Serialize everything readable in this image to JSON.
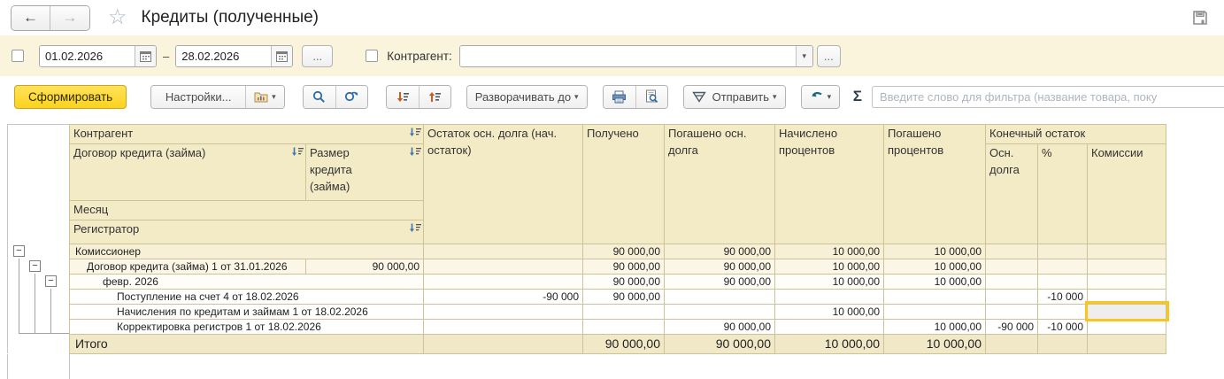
{
  "glyphs": {
    "back": "←",
    "forward": "→",
    "star": "☆",
    "dash": "–",
    "ellipsis": "...",
    "caret": "▾",
    "minus": "−",
    "sigma": "Σ"
  },
  "titlebar": {
    "title": "Кредиты (полученные)"
  },
  "filterbar": {
    "date_from": "01.02.2026",
    "date_to": "28.02.2026",
    "counterparty_label": "Контрагент:",
    "counterparty_value": ""
  },
  "toolbar": {
    "generate_label": "Сформировать",
    "settings_label": "Настройки...",
    "expand_to_label": "Разворачивать до",
    "send_label": "Отправить",
    "filter_placeholder": "Введите слово для фильтра (название товара, поку"
  },
  "report": {
    "headers": {
      "kontragent": "Контрагент",
      "dogovor": "Договор кредита (займа)",
      "razmer": "Размер кредита (займа)",
      "mesyac": "Месяц",
      "registrator": "Регистратор",
      "ostatok": "Остаток осн. долга (нач. остаток)",
      "polucheno": "Получено",
      "pogasheno_osn": "Погашено осн. долга",
      "nachisleno": "Начислено процентов",
      "pogasheno_proc": "Погашено процентов",
      "konechny": "Конечный остаток",
      "osn_dolga": "Осн. долга",
      "pct": "%",
      "komissii": "Комиссии"
    },
    "rows": [
      {
        "label": "Комиссионер",
        "polucheno": "90 000,00",
        "pogasheno_osn": "90 000,00",
        "nachisleno": "10 000,00",
        "pogasheno_proc": "10 000,00"
      },
      {
        "label": "Договор кредита (займа) 1 от 31.01.2026",
        "razmer": "90 000,00",
        "polucheno": "90 000,00",
        "pogasheno_osn": "90 000,00",
        "nachisleno": "10 000,00",
        "pogasheno_proc": "10 000,00"
      },
      {
        "label": "февр. 2026",
        "polucheno": "90 000,00",
        "pogasheno_osn": "90 000,00",
        "nachisleno": "10 000,00",
        "pogasheno_proc": "10 000,00"
      },
      {
        "label": "Поступление на счет 4 от 18.02.2026",
        "ostatok": "-90 000",
        "polucheno": "90 000,00",
        "pct": "-10 000"
      },
      {
        "label": "Начисления по кредитам и займам 1 от 18.02.2026",
        "nachisleno": "10 000,00"
      },
      {
        "label": "Корректировка регистров 1 от 18.02.2026",
        "pogasheno_osn": "90 000,00",
        "pogasheno_proc": "10 000,00",
        "osn_dolga": "-90 000",
        "pct": "-10 000"
      },
      {
        "label": "Итого",
        "polucheno": "90 000,00",
        "pogasheno_osn": "90 000,00",
        "nachisleno": "10 000,00",
        "pogasheno_proc": "10 000,00"
      }
    ]
  }
}
